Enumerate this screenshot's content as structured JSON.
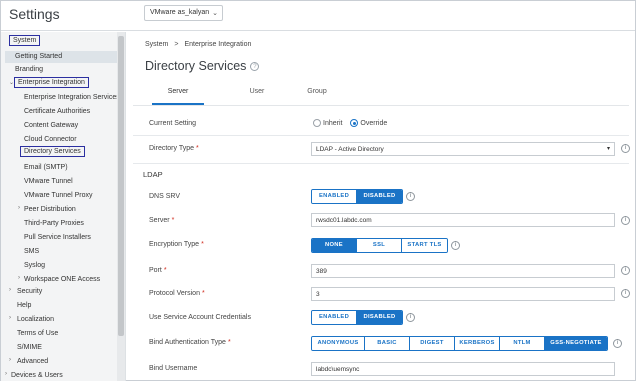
{
  "header": {
    "title": "Settings",
    "org_selector": "VMware as_kalyan"
  },
  "sidebar": {
    "system": "System",
    "getting_started": "Getting Started",
    "branding": "Branding",
    "enterprise_integration": "Enterprise Integration",
    "enterprise_integration_services": "Enterprise Integration Services",
    "certificate_authorities": "Certificate Authorities",
    "content_gateway": "Content Gateway",
    "cloud_connector": "Cloud Connector",
    "directory_services": "Directory Services",
    "email_smtp": "Email (SMTP)",
    "vmware_tunnel": "VMware Tunnel",
    "vmware_tunnel_proxy": "VMware Tunnel Proxy",
    "peer_distribution": "Peer Distribution",
    "third_party_proxies": "Third-Party Proxies",
    "pull_service_installers": "Pull Service Installers",
    "sms": "SMS",
    "syslog": "Syslog",
    "workspace_one_access": "Workspace ONE Access",
    "security": "Security",
    "help": "Help",
    "localization": "Localization",
    "terms_of_use": "Terms of Use",
    "smime": "S/MIME",
    "advanced": "Advanced",
    "devices_users": "Devices & Users"
  },
  "breadcrumb": {
    "root": "System",
    "separator": ">",
    "current": "Enterprise Integration"
  },
  "page": {
    "title": "Directory Services",
    "help_icon": "?"
  },
  "tabs": [
    "Server",
    "User",
    "Group"
  ],
  "form": {
    "current_setting": {
      "label": "Current Setting",
      "options": [
        "Inherit",
        "Override"
      ],
      "selected": "Override"
    },
    "directory_type": {
      "label": "Directory Type",
      "value": "LDAP - Active Directory"
    },
    "ldap_section": "LDAP",
    "dns_srv": {
      "label": "DNS SRV",
      "options": [
        "ENABLED",
        "DISABLED"
      ],
      "selected": "DISABLED"
    },
    "server": {
      "label": "Server",
      "value": "rwsdc01.labdc.com"
    },
    "encryption_type": {
      "label": "Encryption Type",
      "options": [
        "NONE",
        "SSL",
        "START TLS"
      ],
      "selected": "NONE"
    },
    "port": {
      "label": "Port",
      "value": "389"
    },
    "protocol_version": {
      "label": "Protocol Version",
      "value": "3"
    },
    "use_service_account": {
      "label": "Use Service Account Credentials",
      "options": [
        "ENABLED",
        "DISABLED"
      ],
      "selected": "DISABLED"
    },
    "bind_auth_type": {
      "label": "Bind Authentication Type",
      "options": [
        "ANONYMOUS",
        "BASIC",
        "DIGEST",
        "KERBEROS",
        "NTLM",
        "GSS-NEGOTIATE"
      ],
      "selected": "GSS-NEGOTIATE"
    },
    "bind_username": {
      "label": "Bind Username",
      "value": "labdc\\uemsync"
    }
  },
  "icons": {
    "info": "i",
    "required_mark": "*"
  },
  "colors": {
    "accent": "#1a73c6",
    "highlight_box": "#2b2fa0",
    "required": "#d0291b"
  }
}
